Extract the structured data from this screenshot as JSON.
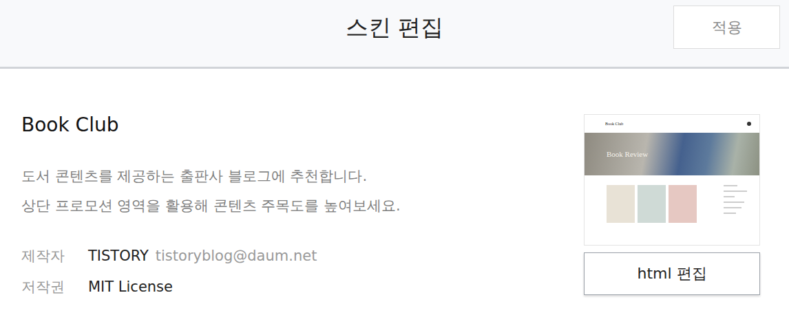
{
  "header": {
    "title": "스킨 편집",
    "apply_button": "적용"
  },
  "skin": {
    "name": "Book Club",
    "description": [
      "도서 콘텐츠를 제공하는 출판사 블로그에 추천합니다.",
      "상단 프로모션 영역을 활용해 콘텐츠 주목도를 높여보세요."
    ],
    "meta": [
      {
        "label": "제작자",
        "value": "TISTORY",
        "extra": "tistoryblog@daum.net"
      },
      {
        "label": "저작권",
        "value": "MIT License",
        "extra": ""
      }
    ]
  },
  "preview": {
    "blog_title": "Book Club",
    "banner": "Book Review",
    "books": [
      {
        "color": "#e8e2d6"
      },
      {
        "color": "#cfdad6"
      },
      {
        "color": "#e6c8c2"
      }
    ]
  },
  "edit_button": "html 편집"
}
